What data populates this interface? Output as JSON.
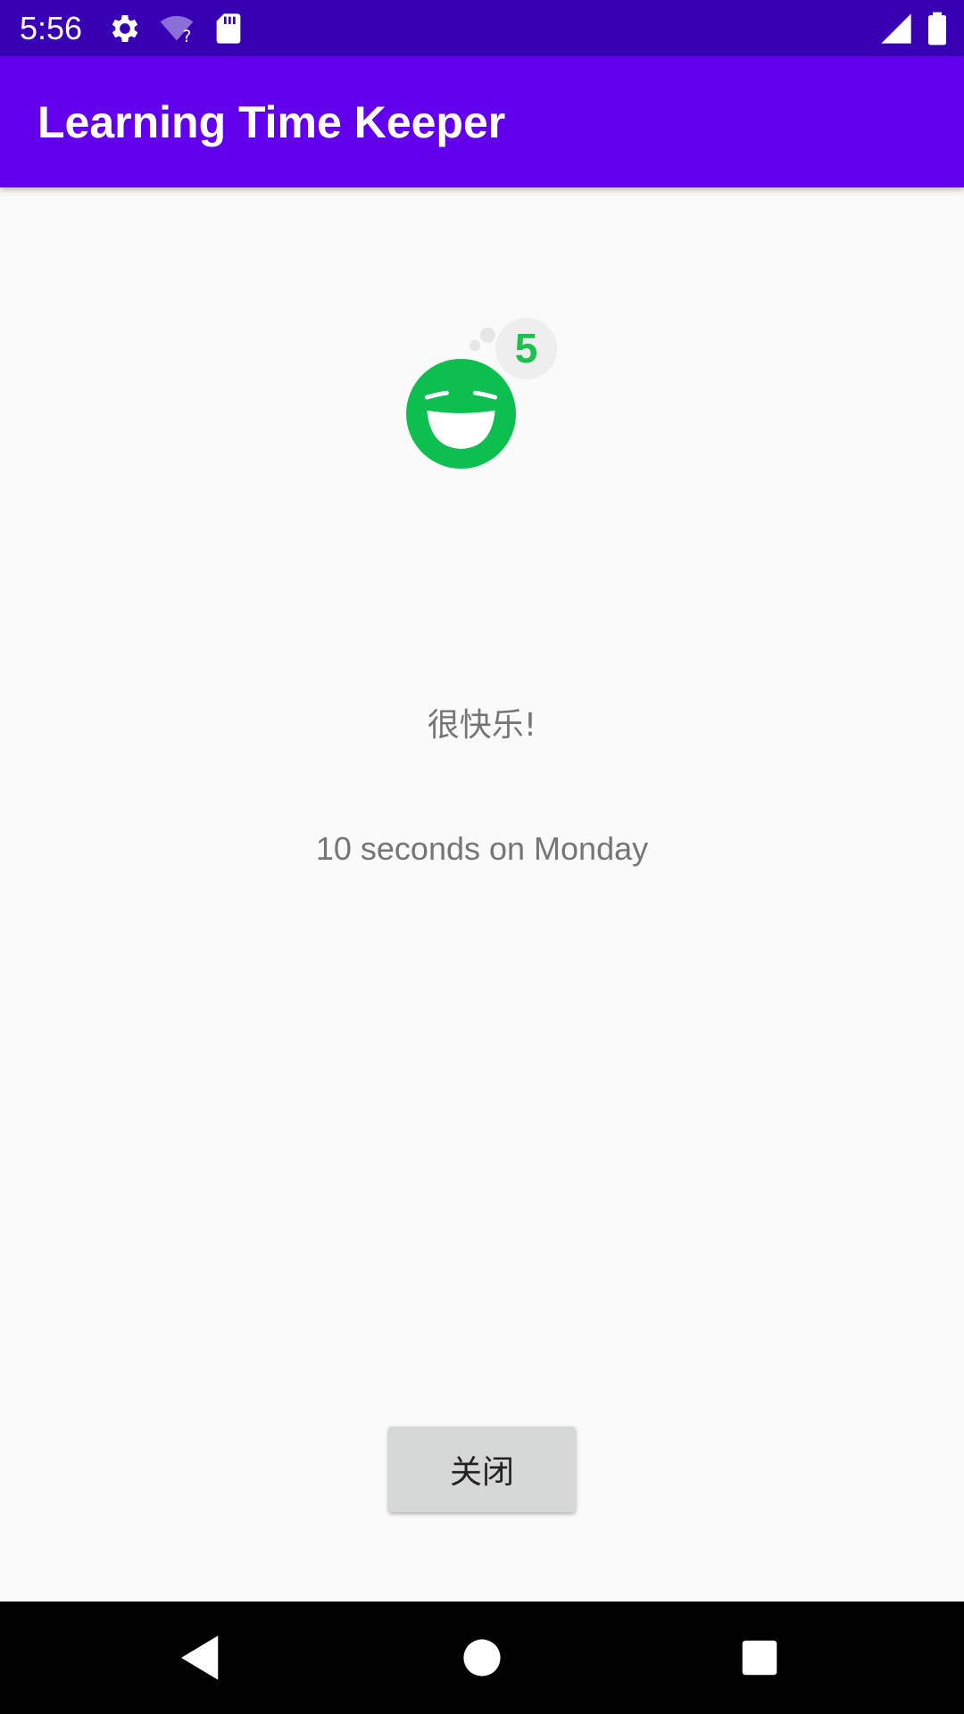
{
  "status_bar": {
    "time": "5:56",
    "icons": [
      "settings-icon",
      "wifi-unknown-icon",
      "sd-card-icon",
      "cell-signal-icon",
      "battery-icon"
    ]
  },
  "app_bar": {
    "title": "Learning Time Keeper"
  },
  "mood": {
    "icon": "laughing-face-icon",
    "color": "#0dbf4e",
    "badge_value": "5",
    "label": "很快乐!"
  },
  "duration": {
    "text": "10 seconds on Monday"
  },
  "actions": {
    "close_label": "关闭"
  },
  "colors": {
    "status_bar": "#3700b3",
    "app_bar": "#6200ee",
    "background": "#fafafa",
    "button": "#d6d7d7",
    "nav_bar": "#000000"
  },
  "nav": {
    "buttons": [
      "back-icon",
      "home-icon",
      "recents-icon"
    ]
  }
}
